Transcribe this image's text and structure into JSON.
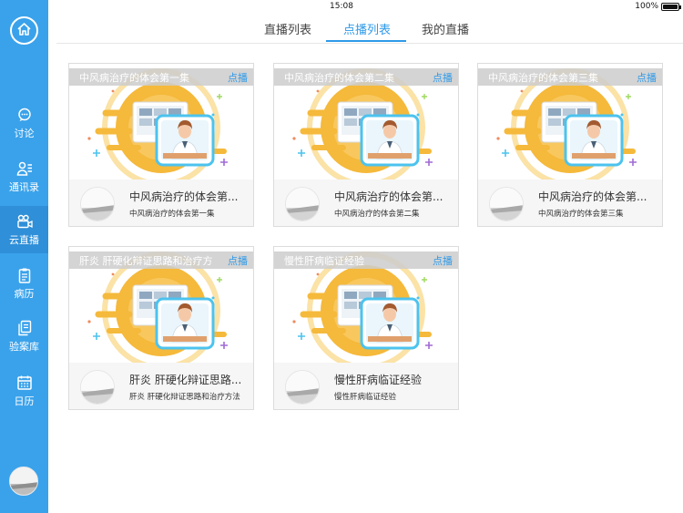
{
  "status_bar": {
    "device": "iPad",
    "time": "15:08",
    "battery": "100%",
    "battery_level": 1.0
  },
  "sidebar": {
    "items": [
      {
        "label": "讨论",
        "icon": "chat-bubble-icon",
        "active": false
      },
      {
        "label": "通讯录",
        "icon": "contacts-icon",
        "active": false
      },
      {
        "label": "云直播",
        "icon": "video-camera-icon",
        "active": true
      },
      {
        "label": "病历",
        "icon": "clipboard-icon",
        "active": false
      },
      {
        "label": "验案库",
        "icon": "document-stack-icon",
        "active": false
      },
      {
        "label": "日历",
        "icon": "calendar-icon",
        "active": false
      }
    ]
  },
  "tabs": [
    {
      "label": "直播列表",
      "active": false
    },
    {
      "label": "点播列表",
      "active": true
    },
    {
      "label": "我的直播",
      "active": false
    }
  ],
  "cards": [
    {
      "overlay_title": "中风病治疗的体会第一集",
      "tag": "点播",
      "title": "中风病治疗的体会第...",
      "subtitle": "中风病治疗的体会第一集"
    },
    {
      "overlay_title": "中风病治疗的体会第二集",
      "tag": "点播",
      "title": "中风病治疗的体会第...",
      "subtitle": "中风病治疗的体会第二集"
    },
    {
      "overlay_title": "中风病治疗的体会第三集",
      "tag": "点播",
      "title": "中风病治疗的体会第...",
      "subtitle": "中风病治疗的体会第三集"
    },
    {
      "overlay_title": "肝炎 肝硬化辩证思路和治疗方",
      "tag": "点播",
      "title": "肝炎 肝硬化辩证思路...",
      "subtitle": "肝炎 肝硬化辩证思路和治疗方法"
    },
    {
      "overlay_title": "慢性肝病临证经验",
      "tag": "点播",
      "title": "慢性肝病临证经验",
      "subtitle": "慢性肝病临证经验"
    }
  ],
  "colors": {
    "accent": "#2f9ae8",
    "sidebar": "#3aa2eb",
    "sidebar_active": "#2f8fd8",
    "illustration_orange": "#f5b93b",
    "illustration_blue": "#4cc3ee"
  }
}
